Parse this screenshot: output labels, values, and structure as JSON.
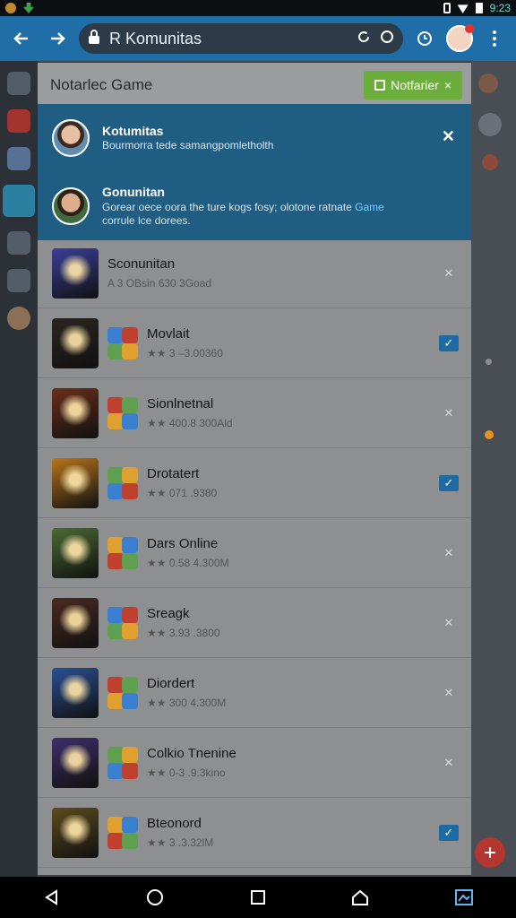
{
  "status": {
    "time": "9:23"
  },
  "browser": {
    "url_text": "R  Komunitas"
  },
  "panel": {
    "title": "Notarlec Game",
    "notif_button": "Notfarier"
  },
  "notifications": [
    {
      "name": "Kotumitas",
      "message": "Bourmorra tede samangpomletholth"
    },
    {
      "name": "Gonunitan",
      "message": "Gorear oece oora the ture kogs fosy; olotone ratnate ",
      "highlight": "Game",
      "message2": "corrule lce dorees."
    }
  ],
  "games": [
    {
      "name": "Sconunitan",
      "meta": "A 3  OBsin  630  3Goad",
      "active": false,
      "art": "#3b3f9a"
    },
    {
      "name": "Movlait",
      "meta": "★★ 3 –3.00360",
      "active": true,
      "art": "#2b2520"
    },
    {
      "name": "Sionlnetnal",
      "meta": "★★ 400.8 300Ald",
      "active": false,
      "art": "#6a2f1a"
    },
    {
      "name": "Drotatert",
      "meta": "★★ 071 .9380",
      "active": true,
      "art": "#b9741a"
    },
    {
      "name": "Dars Online",
      "meta": "★★ 0.58 4.300M",
      "active": false,
      "art": "#4b6a33"
    },
    {
      "name": "Sreagk",
      "meta": "★★ 3.93 .3800",
      "active": false,
      "art": "#4a2a22"
    },
    {
      "name": "Diordert",
      "meta": "★★ 300 4.300M",
      "active": false,
      "art": "#2a4f96"
    },
    {
      "name": "Colkio Tnenine",
      "meta": "★★ 0-3 .9.3kino",
      "active": false,
      "art": "#3d2f6a"
    },
    {
      "name": "Bteonord",
      "meta": "★★ 3 .3.32lM",
      "active": true,
      "art": "#5e4a1e"
    }
  ],
  "colors": {
    "browser_bar": "#1f6ea8",
    "notification_bg": "#1f5d83",
    "accent_green": "#6cae3b",
    "highlight": "#6fd0ff"
  }
}
